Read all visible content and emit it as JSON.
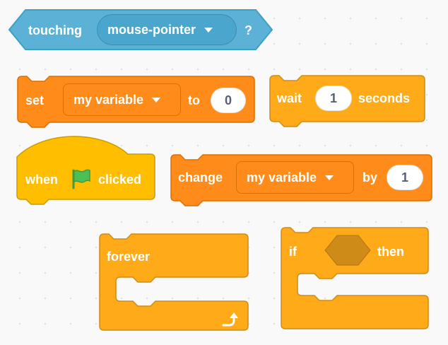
{
  "palette": {
    "sensing": "#5cb1d6",
    "variables": "#ff8c1a",
    "control": "#ffab19",
    "events": "#ffbf00",
    "canvas": "#f9f9f9"
  },
  "blocks": {
    "touching": {
      "label": "touching",
      "dropdown": "mouse-pointer",
      "suffix": "?"
    },
    "set_variable": {
      "label": "set",
      "dropdown": "my variable",
      "joiner": "to",
      "value": "0"
    },
    "wait": {
      "label": "wait",
      "value": "1",
      "suffix": "seconds"
    },
    "when_flag_clicked": {
      "label": "when",
      "icon": "green-flag-icon",
      "suffix": "clicked"
    },
    "change_variable": {
      "label": "change",
      "dropdown": "my variable",
      "joiner": "by",
      "value": "1"
    },
    "forever": {
      "label": "forever",
      "icon": "loop-arrow-icon"
    },
    "if_then": {
      "label": "if",
      "suffix": "then"
    }
  }
}
